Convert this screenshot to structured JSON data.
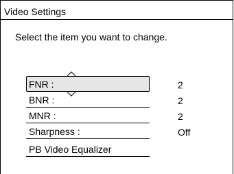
{
  "window": {
    "title": "Video Settings"
  },
  "instruction": "Select the item you want to change.",
  "settings": [
    {
      "label": "FNR :",
      "value": "2",
      "selected": true
    },
    {
      "label": "BNR :",
      "value": "2",
      "selected": false
    },
    {
      "label": "MNR :",
      "value": "2",
      "selected": false
    },
    {
      "label": "Sharpness :",
      "value": "Off",
      "selected": false
    },
    {
      "label": "PB Video Equalizer",
      "value": "",
      "selected": false
    }
  ],
  "icons": {
    "up": "caret-up-icon",
    "down": "caret-down-icon"
  },
  "colors": {
    "selected_background": "#e6e6e6",
    "border": "#000000"
  }
}
